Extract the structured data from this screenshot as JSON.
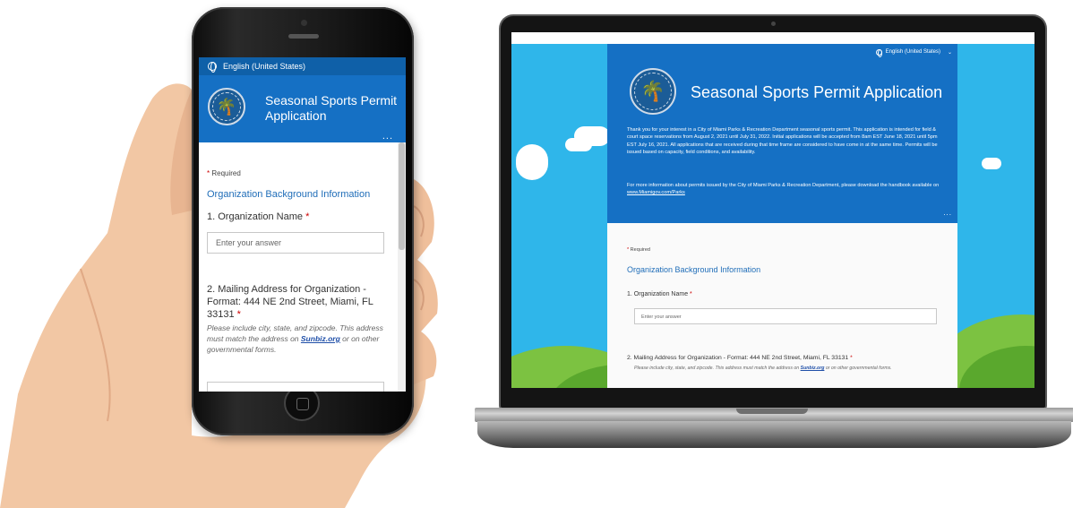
{
  "language_selector": {
    "label": "English (United States)"
  },
  "form": {
    "title": "Seasonal Sports Permit Application",
    "title_line1": "Seasonal Sports Permit",
    "title_line2": "Application",
    "intro": "Thank you for your interest in a City of Miami Parks & Recreation Department seasonal sports permit. This application is intended for field & court space reservations from August 2, 2021 until July 31, 2022. Initial applications will be accepted from 8am EST June 18, 2021 until 5pm EST July 16, 2021. All applications that are received during that time frame are considered to have come in at the same time. Permits will be issued based on capacity, field conditions, and availability.",
    "more_info_prefix": "For more information about permits issued by the City of Miami Parks & Recreation Department, please download the handbook available on ",
    "more_info_link": "www.Miamigov.com/Parks",
    "more_options": "...",
    "required_star": "*",
    "required_label": "Required",
    "section_title": "Organization Background Information",
    "q1": {
      "label": "1. Organization Name",
      "placeholder": "Enter your answer"
    },
    "q2": {
      "label": "2. Mailing Address for Organization - Format: 444 NE 2nd Street, Miami, FL 33131",
      "note_prefix": "Please include city, state, and zipcode. This address must match the address on ",
      "note_link": "Sunbiz.org",
      "note_suffix": " or on other governmental forms."
    }
  },
  "icons": {
    "language": "globe-icon",
    "seal": "city-seal-logo",
    "more": "ellipsis-icon",
    "dropdown": "chevron-down-icon"
  },
  "colors": {
    "header_blue": "#1570c4",
    "lang_bar_blue": "#0f60a8",
    "section_blue": "#1f6db8",
    "required_red": "#cc0000",
    "sky_blue": "#2fb6ea",
    "grass_green": "#7cc241"
  }
}
